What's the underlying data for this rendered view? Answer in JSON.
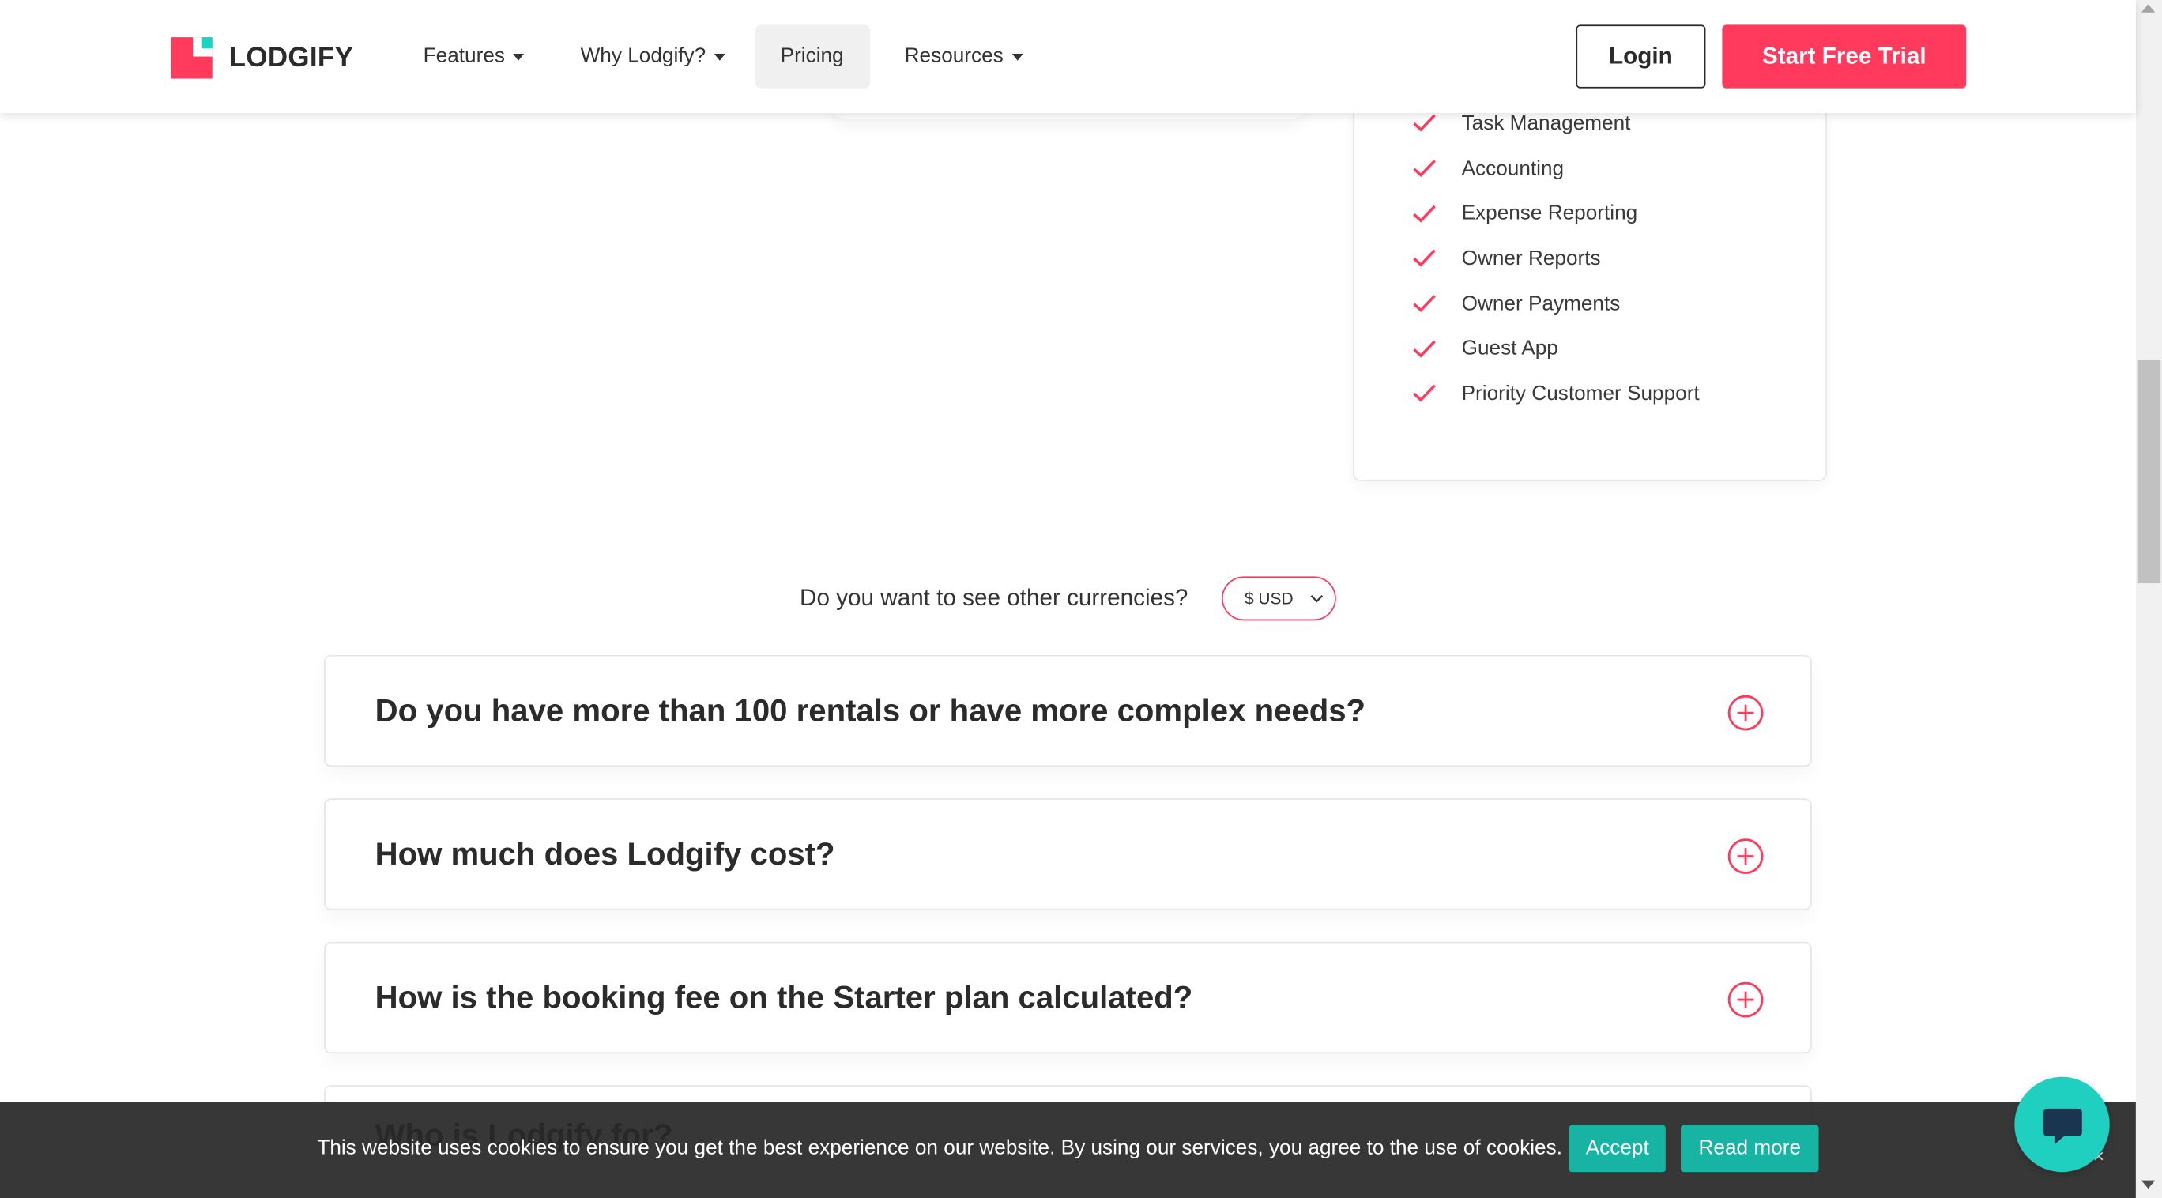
{
  "nav": {
    "brand": "LODGIFY",
    "items": [
      {
        "label": "Features",
        "dropdown": true
      },
      {
        "label": "Why Lodgify?",
        "dropdown": true
      },
      {
        "label": "Pricing",
        "dropdown": false,
        "active": true
      },
      {
        "label": "Resources",
        "dropdown": true
      }
    ],
    "login": "Login",
    "trial": "Start Free Trial"
  },
  "plan": {
    "features": [
      "Task Management",
      "Accounting",
      "Expense Reporting",
      "Owner Reports",
      "Owner Payments",
      "Guest App",
      "Priority Customer Support"
    ]
  },
  "currency": {
    "question": "Do you want to see other currencies?",
    "selected": "$ USD"
  },
  "faq": [
    "Do you have more than 100 rentals or have more complex needs?",
    "How much does Lodgify cost?",
    "How is the booking fee on the Starter plan calculated?",
    "Who is Lodgify for?"
  ],
  "cookie": {
    "text": "This website uses cookies to ensure you get the best experience on our website. By using our services, you agree to the use of cookies.",
    "accept": "Accept",
    "read_more": "Read more",
    "close": "×"
  },
  "colors": {
    "brand_red": "#ff3a5c",
    "brand_teal": "#19d3c5",
    "cookie_button": "#17b3a3"
  },
  "icons": {
    "check": "check-icon",
    "plus": "plus-circle-icon",
    "caret": "caret-down-icon",
    "chat": "chat-bubble-icon"
  }
}
